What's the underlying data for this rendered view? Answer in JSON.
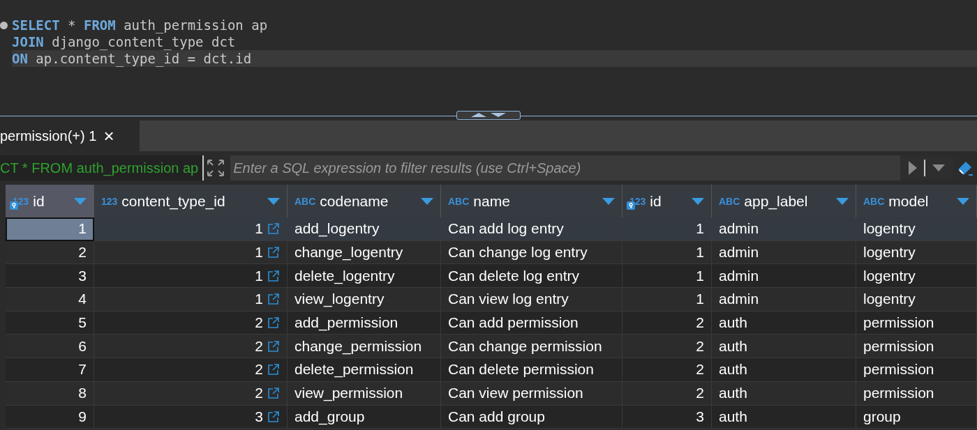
{
  "editor": {
    "lines": [
      {
        "current": false,
        "tokens": [
          {
            "kind": "keyword",
            "text": "SELECT"
          },
          {
            "kind": "plain",
            "text": " * "
          },
          {
            "kind": "keyword",
            "text": "FROM"
          },
          {
            "kind": "plain",
            "text": " auth_permission ap"
          }
        ]
      },
      {
        "current": false,
        "tokens": [
          {
            "kind": "keyword",
            "text": "JOIN"
          },
          {
            "kind": "plain",
            "text": " django_content_type dct"
          }
        ]
      },
      {
        "current": true,
        "tokens": [
          {
            "kind": "keyword",
            "text": "ON"
          },
          {
            "kind": "plain",
            "text": " ap.content_type_id = dct.id"
          }
        ]
      }
    ]
  },
  "result_tab": {
    "label": "permission(+) 1",
    "close": "×"
  },
  "filter": {
    "query": "CT * FROM auth_permission ap",
    "placeholder": "Enter a SQL expression to filter results (use Ctrl+Space)"
  },
  "table": {
    "columns": [
      {
        "type": "123",
        "name": "id",
        "kind": "number",
        "key": true,
        "link": false,
        "selected": true
      },
      {
        "type": "123",
        "name": "content_type_id",
        "kind": "number",
        "key": false,
        "link": true,
        "selected": false
      },
      {
        "type": "ABC",
        "name": "codename",
        "kind": "text",
        "key": false,
        "link": false,
        "selected": false
      },
      {
        "type": "ABC",
        "name": "name",
        "kind": "text",
        "key": false,
        "link": false,
        "selected": false
      },
      {
        "type": "123",
        "name": "id",
        "kind": "number",
        "key": true,
        "link": false,
        "selected": false
      },
      {
        "type": "ABC",
        "name": "app_label",
        "kind": "text",
        "key": false,
        "link": false,
        "selected": false
      },
      {
        "type": "ABC",
        "name": "model",
        "kind": "text",
        "key": false,
        "link": false,
        "selected": false
      }
    ],
    "rows": [
      {
        "selected": true,
        "cells": [
          "1",
          "1",
          "add_logentry",
          "Can add log entry",
          "1",
          "admin",
          "logentry"
        ]
      },
      {
        "selected": false,
        "cells": [
          "2",
          "1",
          "change_logentry",
          "Can change log entry",
          "1",
          "admin",
          "logentry"
        ]
      },
      {
        "selected": false,
        "cells": [
          "3",
          "1",
          "delete_logentry",
          "Can delete log entry",
          "1",
          "admin",
          "logentry"
        ]
      },
      {
        "selected": false,
        "cells": [
          "4",
          "1",
          "view_logentry",
          "Can view log entry",
          "1",
          "admin",
          "logentry"
        ]
      },
      {
        "selected": false,
        "cells": [
          "5",
          "2",
          "add_permission",
          "Can add permission",
          "2",
          "auth",
          "permission"
        ]
      },
      {
        "selected": false,
        "cells": [
          "6",
          "2",
          "change_permission",
          "Can change permission",
          "2",
          "auth",
          "permission"
        ]
      },
      {
        "selected": false,
        "cells": [
          "7",
          "2",
          "delete_permission",
          "Can delete permission",
          "2",
          "auth",
          "permission"
        ]
      },
      {
        "selected": false,
        "cells": [
          "8",
          "2",
          "view_permission",
          "Can view permission",
          "2",
          "auth",
          "permission"
        ]
      },
      {
        "selected": false,
        "cells": [
          "9",
          "3",
          "add_group",
          "Can add group",
          "3",
          "auth",
          "group"
        ]
      }
    ]
  }
}
